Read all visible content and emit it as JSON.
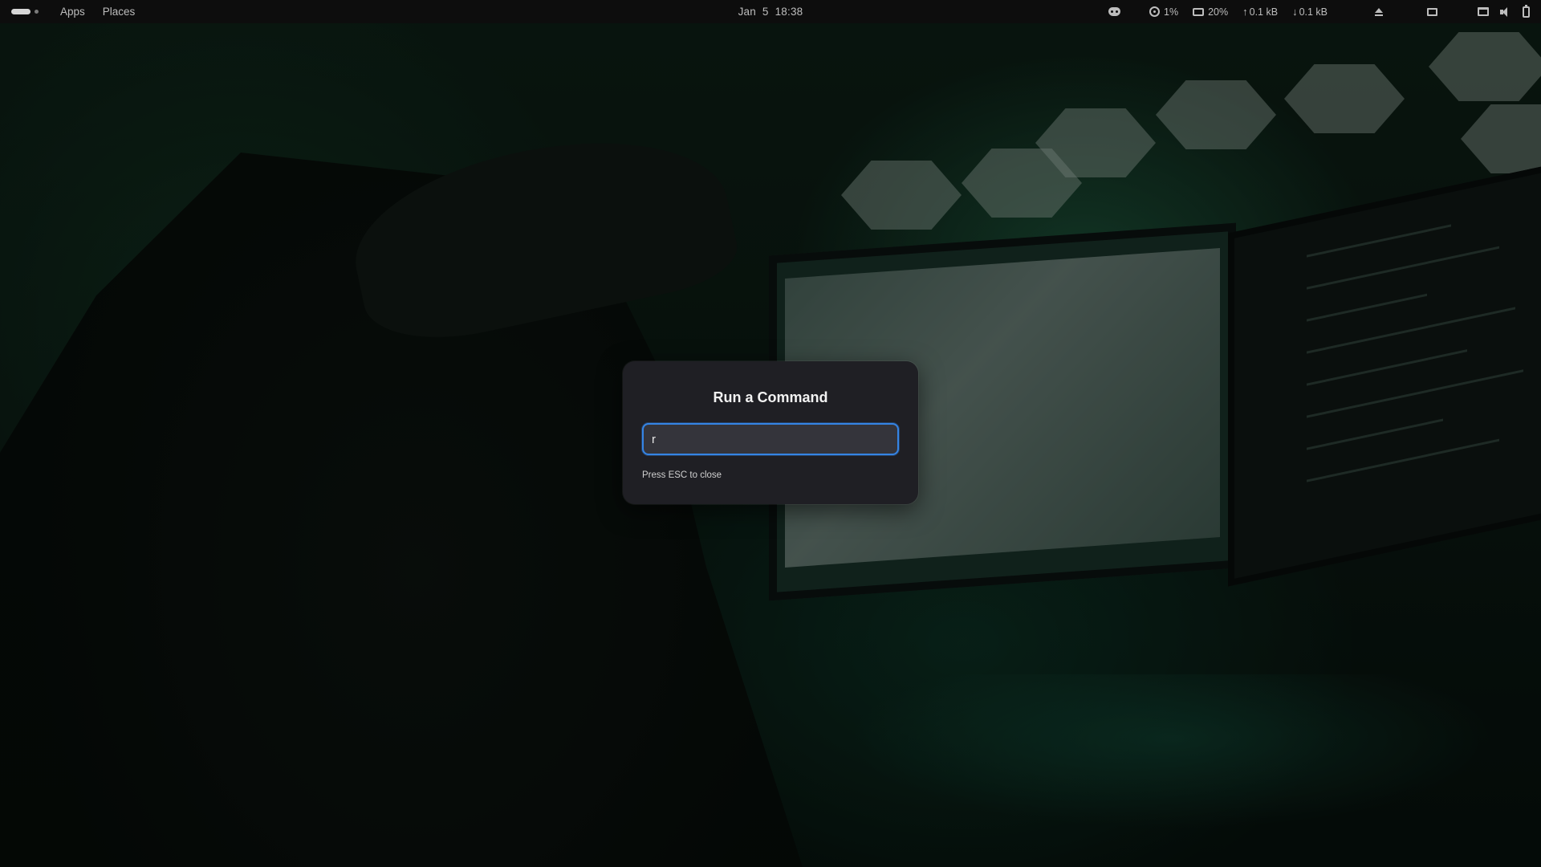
{
  "topbar": {
    "menus": {
      "apps": "Apps",
      "places": "Places"
    },
    "clock": "Jan 5  18:38",
    "indicators": {
      "cpu": "1%",
      "memory": "20%",
      "upload": "0.1 kB",
      "download": "0.1 kB"
    },
    "icons": [
      "activities-indicator",
      "discord-icon",
      "cpu-icon",
      "memory-icon",
      "upload-arrow-icon",
      "download-arrow-icon",
      "eject-icon",
      "window-icon",
      "screen-icon",
      "volume-icon",
      "battery-icon"
    ]
  },
  "run_dialog": {
    "title": "Run a Command",
    "input_value": "r",
    "hint": "Press ESC to close",
    "accent_color": "#3584e4",
    "background_color": "#1f1f24"
  }
}
